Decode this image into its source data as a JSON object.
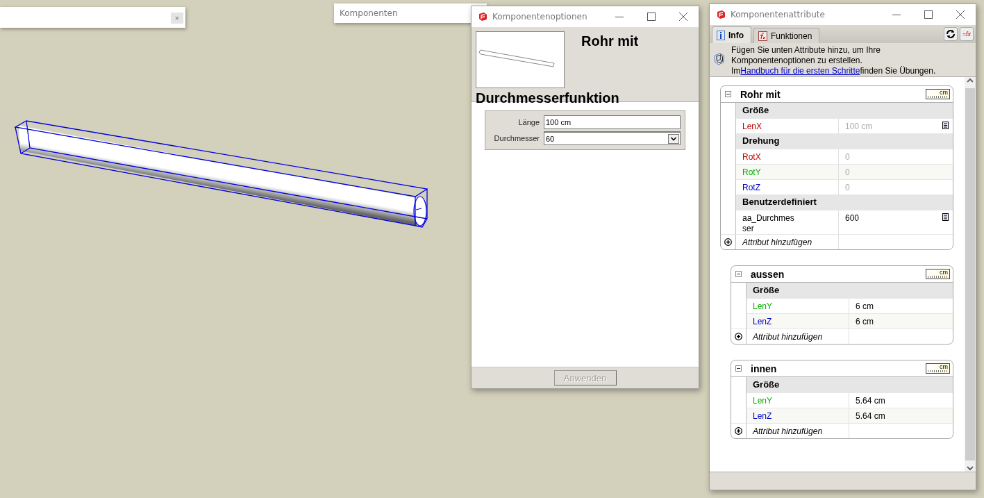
{
  "top_panel": {
    "close_label": "×"
  },
  "components_panel": {
    "title": "Komponenten"
  },
  "options_window": {
    "title": "Komponentenoptionen",
    "component_name_lines": [
      "Rohr mit",
      "Durchmesserfunktion"
    ],
    "fields": [
      {
        "label": "Länge",
        "kind": "text",
        "value": "100 cm"
      },
      {
        "label": "Durchmesser",
        "kind": "dropdown",
        "value": "60"
      }
    ],
    "apply_button": {
      "label": "Anwenden",
      "disabled": true
    }
  },
  "attributes_window": {
    "title": "Komponentenattribute",
    "tabs": [
      {
        "label": "Info",
        "kind": "info",
        "selected": true
      },
      {
        "label": "Funktionen",
        "kind": "functions",
        "selected": false
      }
    ],
    "formula_button": {
      "label": "=fx"
    },
    "info_before": "Fügen Sie unten Attribute hinzu, um Ihre Komponentenoptionen zu erstellen. Im",
    "info_link": "Handbuch für die ersten Schritte",
    "info_after": "finden Sie Übungen.",
    "components": [
      {
        "name": "Rohr mit",
        "expanded": true,
        "unit": "cm",
        "add_label": "Attribut hinzufügen",
        "groups": [
          {
            "title": "Größe",
            "rows": [
              {
                "name": "LenX",
                "color": "#c00000",
                "value": "100 cm",
                "disabled": true,
                "formula": true
              }
            ]
          },
          {
            "title": "Drehung",
            "rows": [
              {
                "name": "RotX",
                "color": "#c00000",
                "value": "0",
                "disabled": true,
                "formula": false
              },
              {
                "name": "RotY",
                "color": "#00b000",
                "value": "0",
                "disabled": true,
                "formula": false
              },
              {
                "name": "RotZ",
                "color": "#0000c0",
                "value": "0",
                "disabled": true,
                "formula": false
              }
            ]
          },
          {
            "title": "Benutzerdefiniert",
            "rows": [
              {
                "name": "aa_Durchmesser",
                "color": "#000000",
                "value": "600",
                "disabled": false,
                "formula": true
              }
            ]
          }
        ],
        "children": [
          {
            "name": "aussen",
            "expanded": true,
            "unit": "cm",
            "add_label": "Attribut hinzufügen",
            "groups": [
              {
                "title": "Größe",
                "rows": [
                  {
                    "name": "LenY",
                    "color": "#00b000",
                    "value": "6 cm",
                    "disabled": false,
                    "formula": false
                  },
                  {
                    "name": "LenZ",
                    "color": "#0000c0",
                    "value": "6 cm",
                    "disabled": false,
                    "formula": false
                  }
                ]
              }
            ]
          },
          {
            "name": "innen",
            "expanded": true,
            "unit": "cm",
            "add_label": "Attribut hinzufügen",
            "groups": [
              {
                "title": "Größe",
                "rows": [
                  {
                    "name": "LenY",
                    "color": "#00b000",
                    "value": "5.64 cm",
                    "disabled": false,
                    "formula": false
                  },
                  {
                    "name": "LenZ",
                    "color": "#0000c0",
                    "value": "5.64 cm",
                    "disabled": false,
                    "formula": false
                  }
                ]
              }
            ]
          }
        ]
      }
    ]
  }
}
